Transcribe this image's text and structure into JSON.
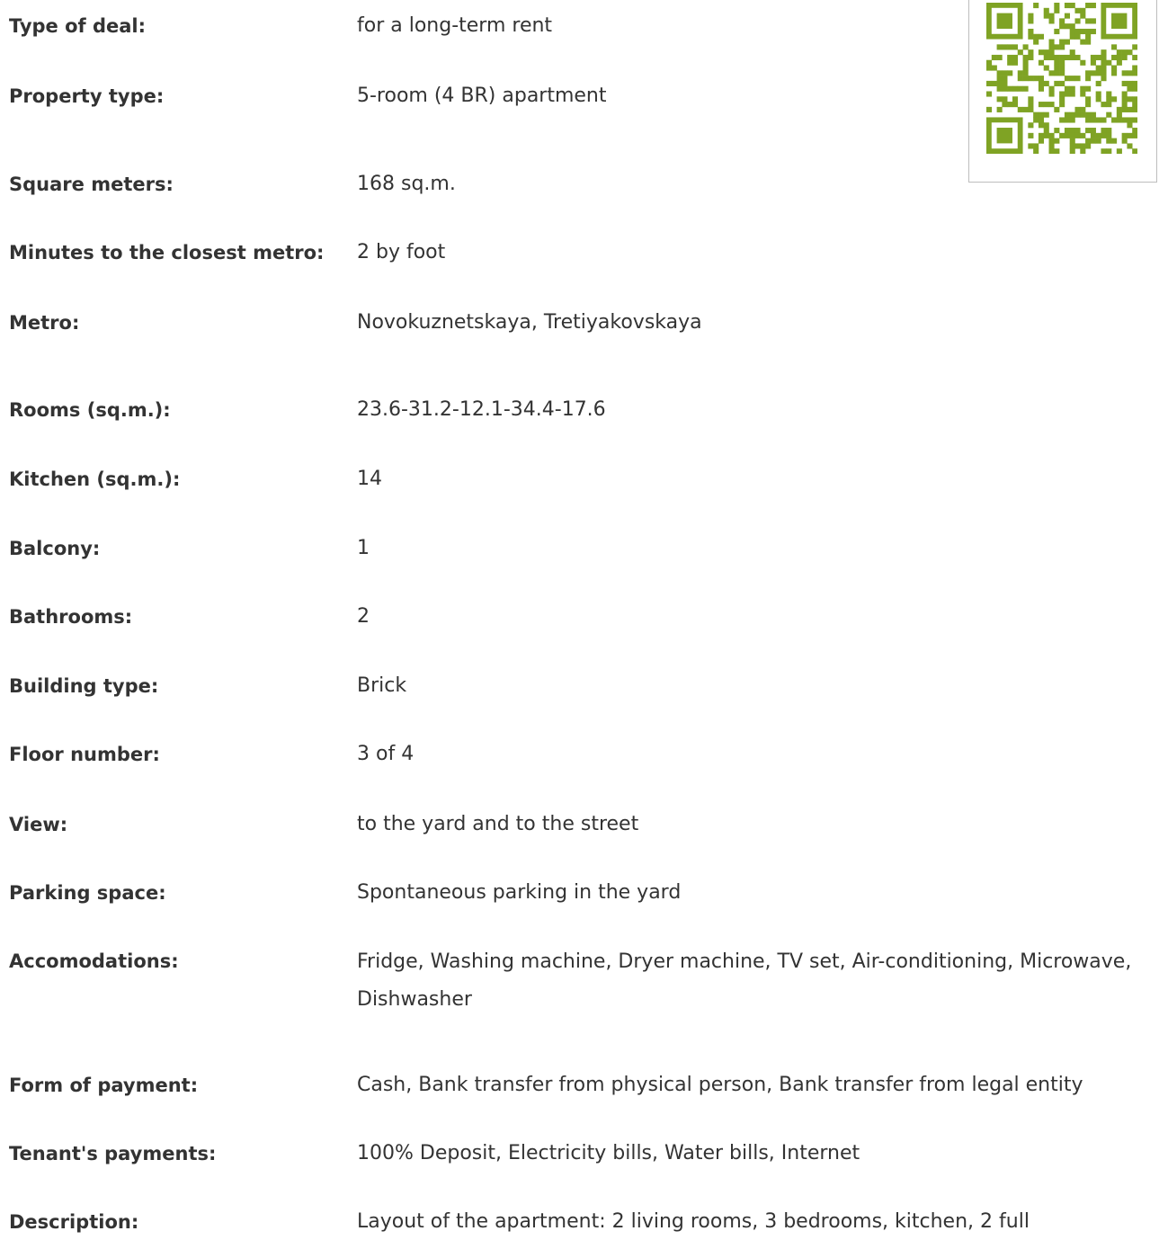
{
  "qr": {
    "icon": "qr-code-icon",
    "color": "#7fa324"
  },
  "properties": [
    {
      "label": "Type of deal:",
      "value": "for a long-term rent"
    },
    {
      "label": "Property type:",
      "value": "5-room (4 BR) apartment"
    },
    {
      "label": "Square meters:",
      "value": "168 sq.m."
    },
    {
      "label": "Minutes to the closest metro:",
      "value": "2 by foot"
    },
    {
      "label": "Metro:",
      "value": "Novokuznetskaya, Tretiyakovskaya"
    },
    {
      "label": "Rooms (sq.m.):",
      "value": "23.6-31.2-12.1-34.4-17.6"
    },
    {
      "label": "Kitchen (sq.m.):",
      "value": "14"
    },
    {
      "label": "Balcony:",
      "value": "1"
    },
    {
      "label": "Bathrooms:",
      "value": "2"
    },
    {
      "label": "Building type:",
      "value": "Brick"
    },
    {
      "label": "Floor number:",
      "value": "3 of 4"
    },
    {
      "label": "View:",
      "value": "to the yard and to the street"
    },
    {
      "label": "Parking space:",
      "value": "Spontaneous parking in the yard"
    },
    {
      "label": "Accomodations:",
      "value": "Fridge, Washing machine, Dryer machine, TV set, Air-conditioning, Microwave, Dishwasher"
    },
    {
      "label": "Form of payment:",
      "value": "Cash, Bank transfer from physical person, Bank transfer from legal entity"
    },
    {
      "label": "Tenant's payments:",
      "value": "100% Deposit, Electricity bills, Water bills, Internet"
    },
    {
      "label": "Description:",
      "value": "Layout of the apartment: 2 living rooms, 3 bedrooms, kitchen, 2 full"
    }
  ]
}
